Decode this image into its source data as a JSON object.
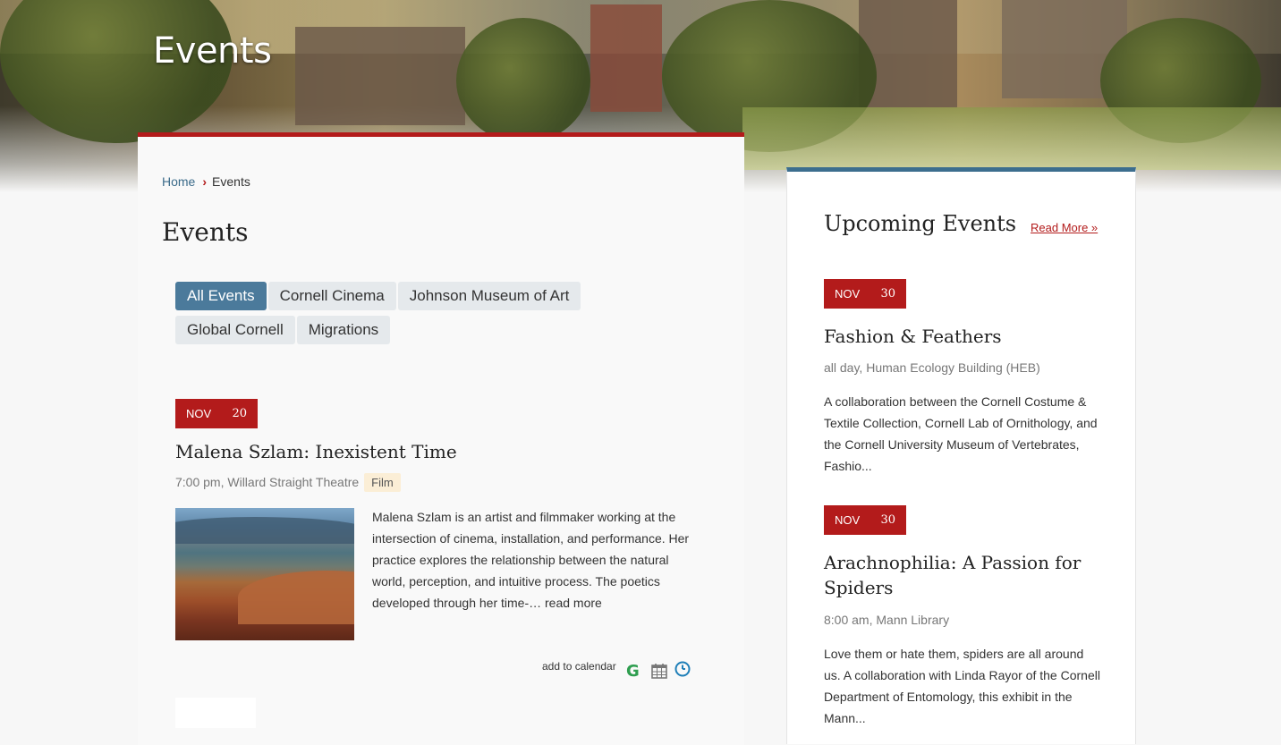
{
  "hero": {
    "title": "Events"
  },
  "breadcrumb": {
    "home": "Home",
    "separator": "›",
    "current": "Events"
  },
  "page_title": "Events",
  "filters": [
    "All Events",
    "Cornell Cinema",
    "Johnson Museum of Art",
    "Global Cornell",
    "Migrations"
  ],
  "active_filter": "All Events",
  "main_event": {
    "month": "NOV",
    "day": "20",
    "title": "Malena Szlam: Inexistent Time",
    "meta": "7:00 pm, Willard Straight Theatre",
    "tag": "Film",
    "description": "Malena Szlam is an artist and filmmaker working at the intersection of cinema, installation, and performance. Her practice explores the relationship between the natural world, perception, and intuitive process. The poetics developed through her time-…",
    "read_more": "read more",
    "add_to_calendar": "add to calendar"
  },
  "calendar_icons": [
    "google-calendar-icon",
    "calendar-grid-icon",
    "clock-icon"
  ],
  "sidebar": {
    "title": "Upcoming Events",
    "read_more": "Read More »",
    "events": [
      {
        "month": "NOV",
        "day": "30",
        "title": "Fashion & Feathers",
        "meta": "all day, Human Ecology Building (HEB)",
        "description": "A collaboration between the Cornell Costume & Textile Collection, Cornell Lab of Ornithology, and the Cornell University Museum of Vertebrates, Fashio..."
      },
      {
        "month": "NOV",
        "day": "30",
        "title": "Arachnophilia: A Passion for Spiders",
        "meta": "8:00 am, Mann Library",
        "description": "Love them or hate them, spiders are all around us. A collaboration with Linda Rayor of the Cornell Department of Entomology, this exhibit in the Mann..."
      }
    ]
  },
  "colors": {
    "cornell_red": "#b31b1b",
    "blue_accent": "#3c6e8e",
    "active_filter_bg": "#4b7a9b",
    "filter_bg": "#e5e9ec",
    "tag_bg": "#fbeed6"
  }
}
